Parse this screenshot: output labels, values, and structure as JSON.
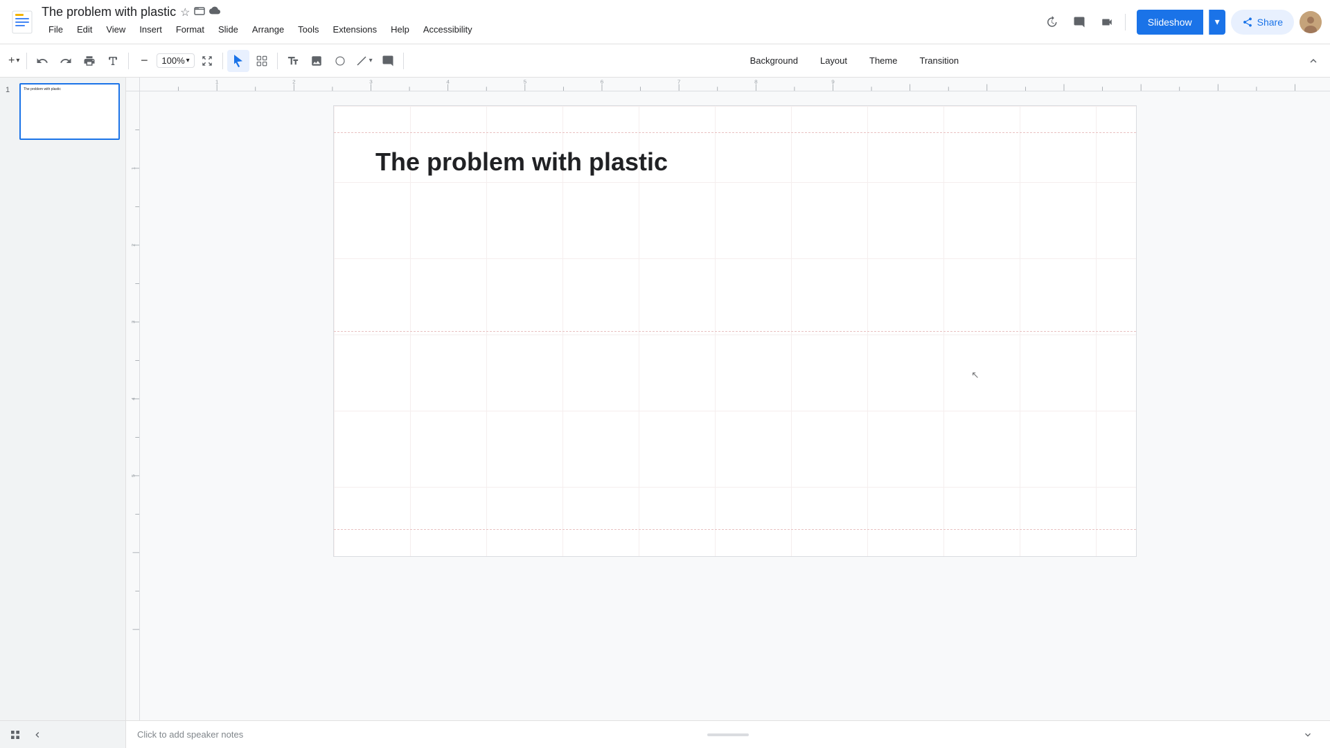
{
  "app": {
    "logo_color": "#F4B400",
    "title": "The problem with plastic",
    "star_icon": "★",
    "folder_icon": "📁",
    "cloud_icon": "☁"
  },
  "menu": {
    "items": [
      "File",
      "Edit",
      "View",
      "Insert",
      "Format",
      "Slide",
      "Arrange",
      "Tools",
      "Extensions",
      "Help",
      "Accessibility"
    ]
  },
  "toolbar": {
    "zoom_level": "100%",
    "undo": "↩",
    "redo": "↪",
    "print": "🖨",
    "cursor_icon": "↗",
    "select_icon": "⬜"
  },
  "format_buttons": {
    "background": "Background",
    "layout": "Layout",
    "theme": "Theme",
    "transition": "Transition"
  },
  "slideshow_btn": "Slideshow",
  "share_btn": "Share",
  "slide": {
    "number": 1,
    "thumb_text": "The problem with plastic",
    "title": "The problem with plastic"
  },
  "notes": {
    "placeholder": "Click to add speaker notes"
  },
  "bottom_icons": {
    "grid": "⊞",
    "collapse": "‹"
  },
  "toolbar_icons": {
    "add": "+",
    "undo": "↩",
    "redo": "↪",
    "print": "🖨",
    "paintformat": "🖌",
    "zoom": "🔍",
    "cursor": "↖",
    "select_all": "⬜",
    "text": "T",
    "image": "🖼",
    "shape": "◯",
    "line": "/",
    "comment": "💬",
    "arrow_down": "▾"
  },
  "top_right_icons": {
    "history": "🕐",
    "comments": "💬",
    "camera": "📷"
  }
}
